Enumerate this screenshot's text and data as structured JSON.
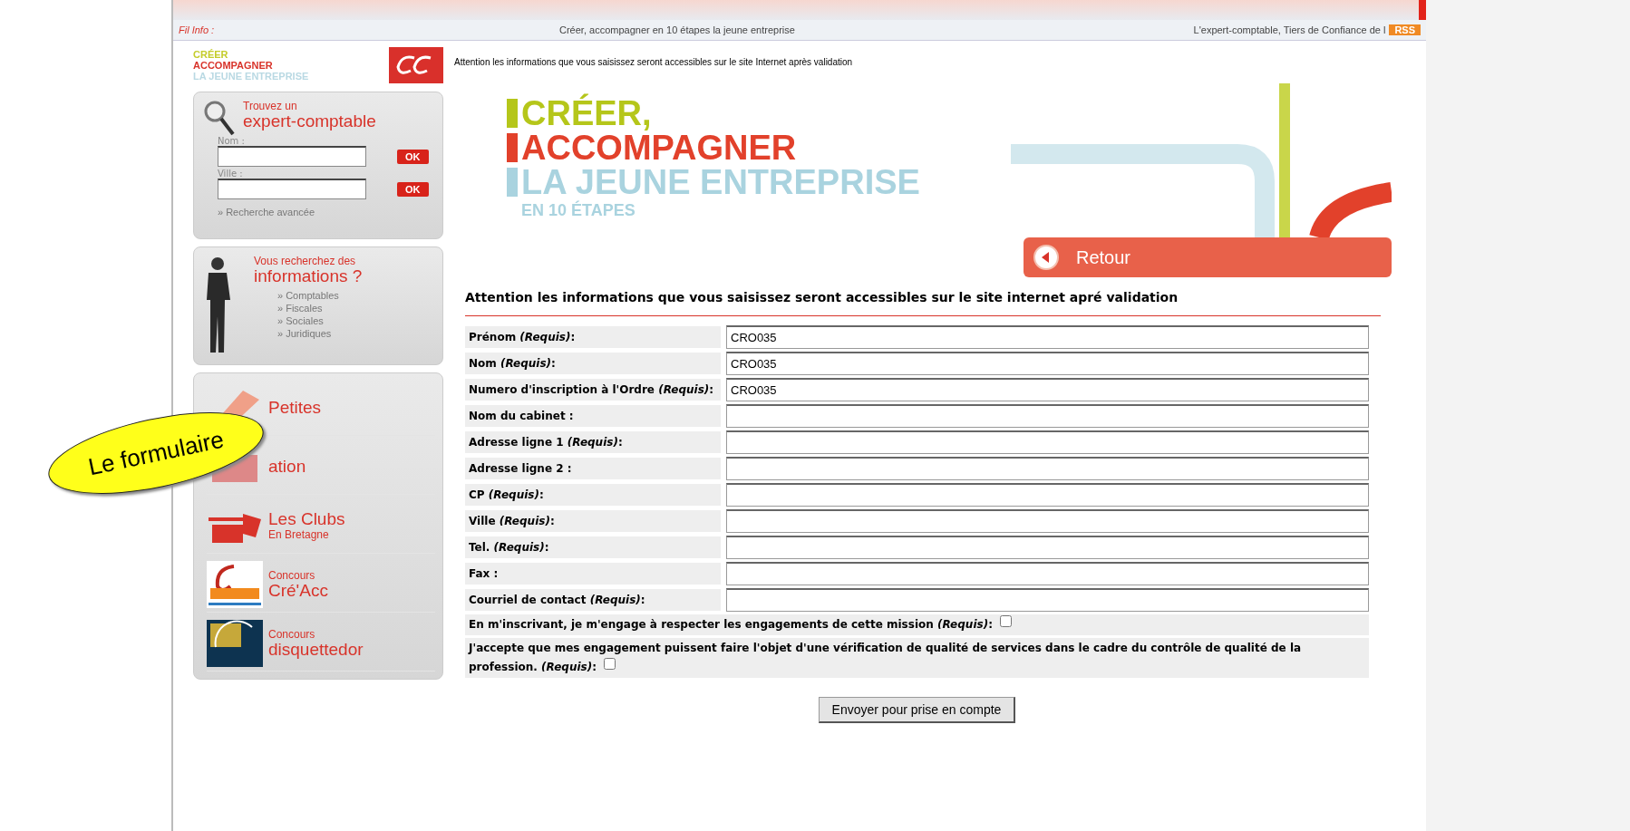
{
  "info_bar": {
    "label": "Fil Info :",
    "ticker": "Créer, accompagner en 10 étapes la jeune entreprise",
    "tagline": "L'expert-comptable, Tiers de Confiance de l",
    "rss": "RSS"
  },
  "sidebar": {
    "logo": [
      "CRÉER",
      "ACCOMPAGNER",
      "LA JEUNE ENTREPRISE"
    ],
    "search": {
      "kicker": "Trouvez un",
      "title": "expert-comptable",
      "fields": [
        {
          "label": "Nom :",
          "button": "OK"
        },
        {
          "label": "Ville :",
          "button": "OK"
        }
      ],
      "advanced": "» Recherche avancée"
    },
    "info": {
      "kicker": "Vous recherchez des",
      "title": "informations ?",
      "links": [
        "» Comptables",
        "» Fiscales",
        "» Sociales",
        "» Juridiques"
      ]
    },
    "links": [
      {
        "kind": "ads",
        "title": "Petites"
      },
      {
        "kind": "training",
        "title": "ation"
      },
      {
        "kind": "clubs",
        "title": "Les Clubs",
        "subtitle": "En Bretagne"
      },
      {
        "kind": "creacc",
        "subtitle": "Concours",
        "title": "Cré'Acc"
      },
      {
        "kind": "disk",
        "subtitle": "Concours",
        "title": "disquettedor"
      }
    ]
  },
  "annotation": "Le formulaire",
  "notice": "Attention les informations que vous saisissez seront accessibles sur le site Internet après validation",
  "banner": [
    {
      "text": "CRÉER,",
      "color": "#b5c61a"
    },
    {
      "text": "ACCOMPAGNER",
      "color": "#e2412b"
    },
    {
      "text": "LA JEUNE ENTREPRISE",
      "color": "#a9d3df"
    },
    {
      "text": "EN 10 ÉTAPES",
      "color": "#a9d3df"
    }
  ],
  "back_button": "Retour",
  "form": {
    "heading": "Attention les informations que vous saisissez seront accessibles sur le site internet apré validation",
    "fields": [
      {
        "label": "Prénom *(Requis)*:",
        "value": "CRO035"
      },
      {
        "label": "Nom *(Requis)*:",
        "value": "CRO035"
      },
      {
        "label": "Numero d'inscription à l'Ordre *(Requis)*:",
        "value": "CRO035"
      },
      {
        "label": "Nom du cabinet :"
      },
      {
        "label": "Adresse ligne 1 *(Requis)*:"
      },
      {
        "label": "Adresse ligne 2 :"
      },
      {
        "label": "CP *(Requis)*:"
      },
      {
        "label": "Ville *(Requis)*:"
      },
      {
        "label": "Tel. *(Requis)*:"
      },
      {
        "label": "Fax :"
      },
      {
        "label": "Courriel de contact *(Requis)*:"
      }
    ],
    "agreements": [
      {
        "text": "En m'inscrivant, je m'engage à respecter les engagements de cette mission *(Requis)*:",
        "checked": false
      },
      {
        "text": "J'accepte que mes engagement puissent faire l'objet d'une vérification de qualité de services dans le cadre du contrôle de qualité de la profession. *(Requis)*:",
        "checked": false
      }
    ],
    "submit": "Envoyer pour prise en compte"
  }
}
